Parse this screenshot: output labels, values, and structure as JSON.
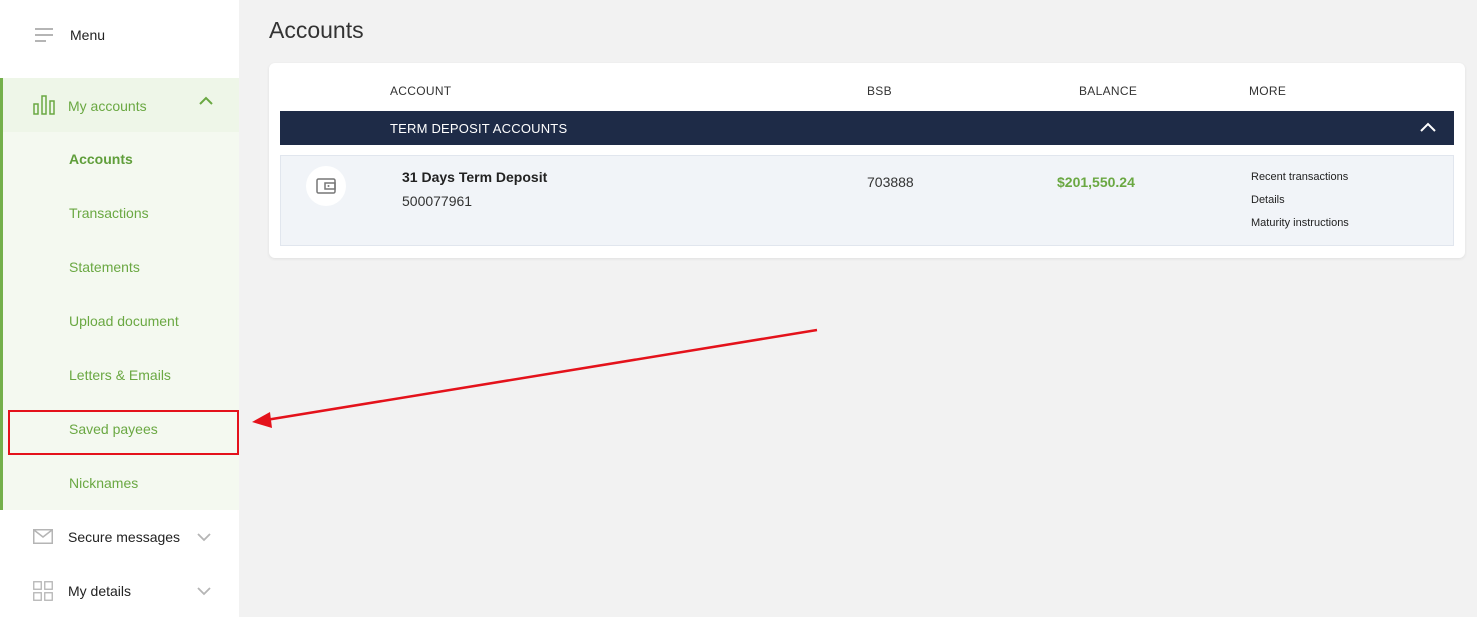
{
  "sidebar": {
    "menu_label": "Menu",
    "group": {
      "label": "My accounts",
      "items": [
        {
          "label": "Accounts",
          "active": true
        },
        {
          "label": "Transactions"
        },
        {
          "label": "Statements"
        },
        {
          "label": "Upload document"
        },
        {
          "label": "Letters & Emails"
        },
        {
          "label": "Saved payees"
        },
        {
          "label": "Nicknames"
        }
      ]
    },
    "nav": [
      {
        "label": "Secure messages",
        "icon": "envelope-icon"
      },
      {
        "label": "My details",
        "icon": "grid-icon"
      }
    ]
  },
  "main": {
    "title": "Accounts",
    "columns": {
      "account": "ACCOUNT",
      "bsb": "BSB",
      "balance": "BALANCE",
      "more": "MORE"
    },
    "group_title": "TERM DEPOSIT ACCOUNTS",
    "accounts": [
      {
        "name": "31 Days Term Deposit",
        "number": "500077961",
        "bsb": "703888",
        "balance": "$201,550.24",
        "more_links": [
          "Recent transactions",
          "Details",
          "Maturity instructions"
        ]
      }
    ]
  },
  "colors": {
    "accent_green": "#6aa842",
    "navy": "#1e2b47",
    "annotation_red": "#e4121b"
  }
}
